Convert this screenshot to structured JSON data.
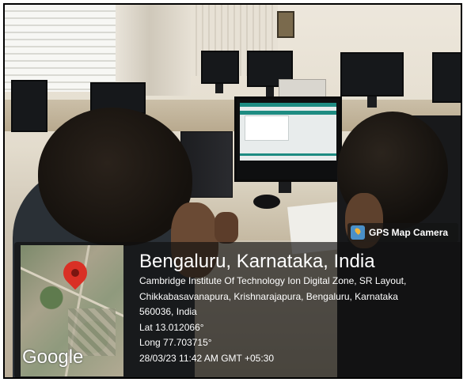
{
  "overlay": {
    "app_label": "GPS Map Camera",
    "app_icon": "gps-map-camera-icon",
    "map_logo": "Google",
    "map_pin_icon": "location-pin-icon",
    "location_title": "Bengaluru, Karnataka, India",
    "address_lines": [
      "Cambridge Institute Of Technology Ion Digital Zone, SR Layout,",
      "Chikkabasavanapura, Krishnarajapura, Bengaluru, Karnataka",
      "560036, India"
    ],
    "latitude": "Lat 13.012066°",
    "longitude": "Long 77.703715°",
    "timestamp": "28/03/23 11:42 AM GMT +05:30",
    "colors": {
      "pin": "#d93025",
      "overlay_bg": "#0f0f0f"
    }
  }
}
